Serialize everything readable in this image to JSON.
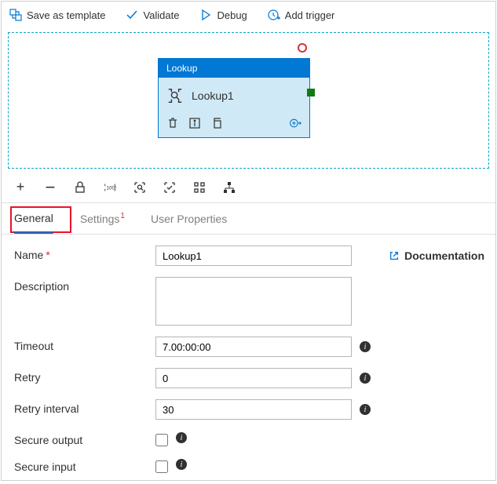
{
  "toolbar": {
    "save_label": "Save as template",
    "validate_label": "Validate",
    "debug_label": "Debug",
    "trigger_label": "Add trigger"
  },
  "node": {
    "type_label": "Lookup",
    "title": "Lookup1"
  },
  "tabs": {
    "general": "General",
    "settings": "Settings",
    "settings_badge": "1",
    "user_properties": "User Properties"
  },
  "form": {
    "name_label": "Name",
    "name_value": "Lookup1",
    "description_label": "Description",
    "description_value": "",
    "timeout_label": "Timeout",
    "timeout_value": "7.00:00:00",
    "retry_label": "Retry",
    "retry_value": "0",
    "retry_interval_label": "Retry interval",
    "retry_interval_value": "30",
    "secure_output_label": "Secure output",
    "secure_input_label": "Secure input"
  },
  "doc_link_label": "Documentation",
  "colors": {
    "primary": "#0078d4",
    "danger": "#d13438"
  }
}
